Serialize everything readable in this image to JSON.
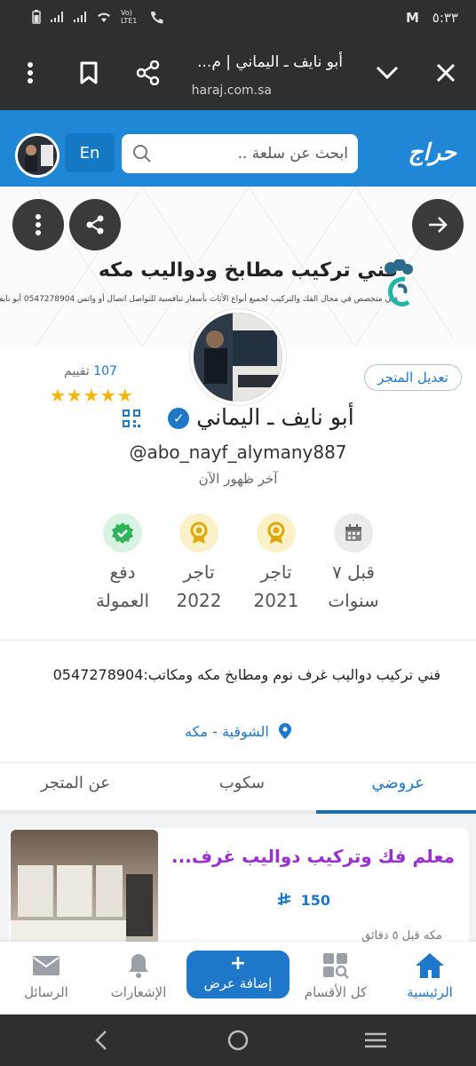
{
  "status_bar": {
    "time": "٥:٣٣",
    "network": "Vo) LTE1"
  },
  "browser": {
    "page_title": "أبو نايف ـ اليماني | م...",
    "url": "haraj.com.sa"
  },
  "header": {
    "logo_text": "حراج",
    "search_placeholder": "ابحث عن سلعة ..",
    "lang_button": "En"
  },
  "banner": {
    "title": "فني تركيب مطابخ ودواليب مكه",
    "subtitle": "فني متخصص في مجال الفك والتركيب لجميع أنواع الأثاث بأسعار تنافسية للتواصل اتصال أو واتس 0547278904 أبو نايف"
  },
  "store": {
    "rating_count": "107",
    "rating_label": "تقييم",
    "stars": "★★★★★",
    "edit_button": "تعديل المتجر",
    "name": "أبو نايف ـ اليماني",
    "handle": "@abo_nayf_alymany887",
    "last_seen": "آخر ظهور الآن",
    "badges": [
      {
        "line1": "قبل ٧",
        "line2": "سنوات",
        "icon": "calendar-icon"
      },
      {
        "line1": "تاجر",
        "line2": "2021",
        "icon": "medal-icon"
      },
      {
        "line1": "تاجر",
        "line2": "2022",
        "icon": "medal-icon"
      },
      {
        "line1": "دفع",
        "line2": "العمولة",
        "icon": "check-badge-icon"
      }
    ],
    "description": "فني تركيب دواليب غرف نوم ومطابخ مكه ومكاتب:0547278904",
    "location": "الشوقية - مكه"
  },
  "tabs": [
    {
      "label": "عروضي",
      "active": true
    },
    {
      "label": "سكوب",
      "active": false
    },
    {
      "label": "عن المتجر",
      "active": false
    }
  ],
  "listing": {
    "title": "معلم فك وتركيب دواليب غرف...",
    "price": "150",
    "meta": "مكه      قبل ٥ دقائق"
  },
  "bottom_nav": {
    "home": "الرئيسية",
    "categories": "كل الأقسام",
    "add_plus": "+",
    "add": "إضافة عرض",
    "notifications": "الإشعارات",
    "messages": "الرسائل"
  },
  "colors": {
    "brand": "#1f87d6",
    "accent": "#1f77c9",
    "listing_title": "#9b2fd0",
    "star": "#f5b400"
  }
}
